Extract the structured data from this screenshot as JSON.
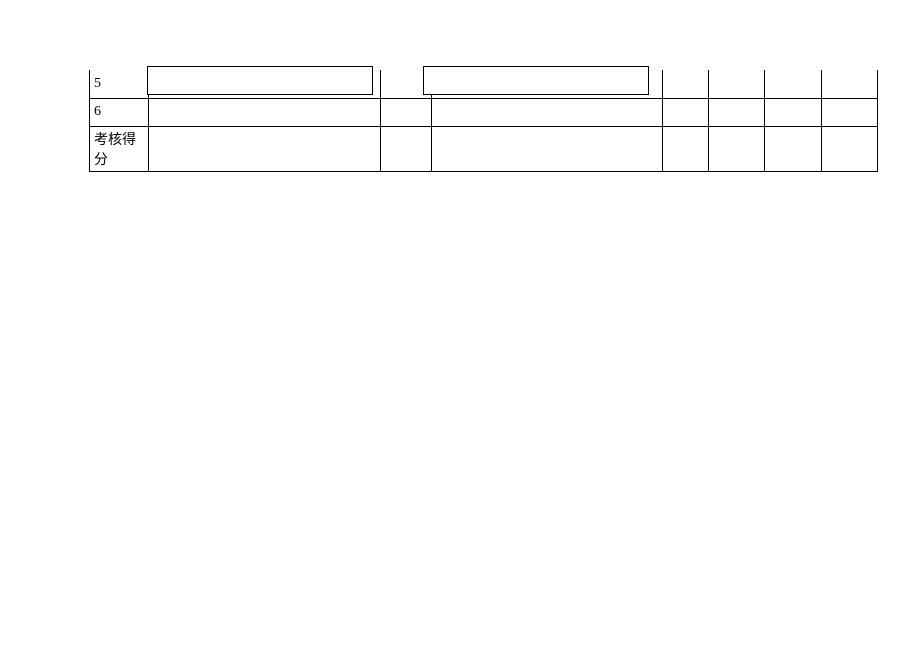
{
  "table": {
    "rows": [
      {
        "c0": "5",
        "c1": "",
        "c2": "",
        "c3": "",
        "c4": "",
        "c5": "",
        "c6": "",
        "c7": ""
      },
      {
        "c0": "6",
        "c1": "",
        "c2": "",
        "c3": "",
        "c4": "",
        "c5": "",
        "c6": "",
        "c7": ""
      },
      {
        "c0": "考核得分",
        "c1": "",
        "c2": "",
        "c3": "",
        "c4": "",
        "c5": "",
        "c6": "",
        "c7": ""
      }
    ]
  }
}
